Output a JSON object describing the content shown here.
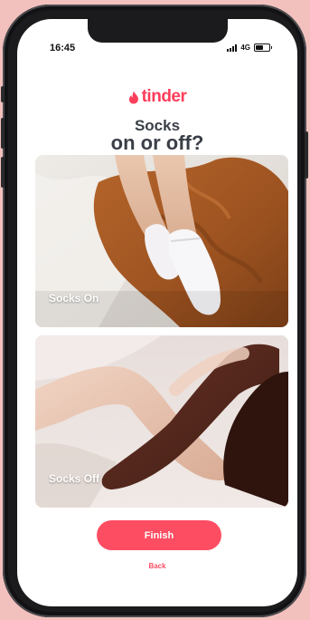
{
  "status_bar": {
    "time": "16:45",
    "network": "4G",
    "battery_level": 0.6
  },
  "brand": {
    "name": "tinder",
    "icon": "flame-icon",
    "color": "#fd3e5a"
  },
  "question": {
    "line1": "Socks",
    "line2": "on or off?"
  },
  "options": [
    {
      "label": "Socks On"
    },
    {
      "label": "Socks Off"
    }
  ],
  "actions": {
    "finish_label": "Finish",
    "back_label": "Back",
    "accent": "#fd4d62"
  }
}
